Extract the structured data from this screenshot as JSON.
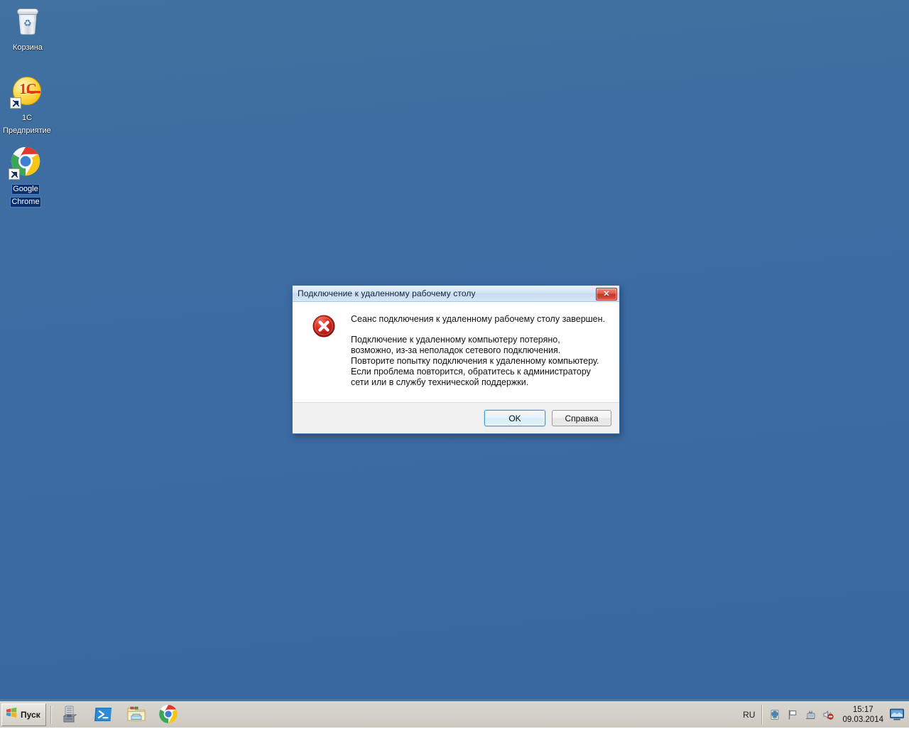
{
  "desktop": {
    "background_color": "#3d6ea5",
    "icons": [
      {
        "name": "recycle-bin",
        "label": "Корзина",
        "selected": false
      },
      {
        "name": "1c-enterprise",
        "label": "1C Предприятие",
        "label_line1": "1C",
        "label_line2": "Предприятие",
        "selected": false,
        "shortcut": true
      },
      {
        "name": "google-chrome",
        "label": "Google Chrome",
        "label_line1": "Google",
        "label_line2": "Chrome",
        "selected": true,
        "shortcut": true
      }
    ]
  },
  "dialog": {
    "title": "Подключение к удаленному рабочему столу",
    "close_icon": "close-icon",
    "close_glyph": "✕",
    "error_icon": "error-icon",
    "heading": "Сеанс подключения к удаленному рабочему столу завершен.",
    "message": "Подключение к удаленному компьютеру потеряно, возможно, из-за неполадок сетевого подключения. Повторите попытку подключения к удаленному компьютеру. Если проблема повторится, обратитесь к администратору сети или в службу технической поддержки.",
    "buttons": {
      "ok": "OK",
      "help": "Справка"
    },
    "accent_color": "#3c9ad1",
    "titlebar_color": "#d4e4f5"
  },
  "taskbar": {
    "start_label": "Пуск",
    "start_icon": "windows-logo-icon",
    "quick_launch": [
      {
        "name": "server-manager-icon",
        "title": "Диспетчер сервера"
      },
      {
        "name": "powershell-icon",
        "title": "Windows PowerShell"
      },
      {
        "name": "windows-explorer-icon",
        "title": "Проводник Windows"
      },
      {
        "name": "google-chrome-icon",
        "title": "Google Chrome"
      }
    ],
    "tray": {
      "language": "RU",
      "icons": [
        {
          "name": "network-globe-icon"
        },
        {
          "name": "action-center-flag-icon"
        },
        {
          "name": "network-connection-icon"
        },
        {
          "name": "volume-muted-icon"
        }
      ],
      "time": "15:17",
      "date": "09.03.2014",
      "show_desktop_icon": "show-desktop-icon"
    }
  }
}
